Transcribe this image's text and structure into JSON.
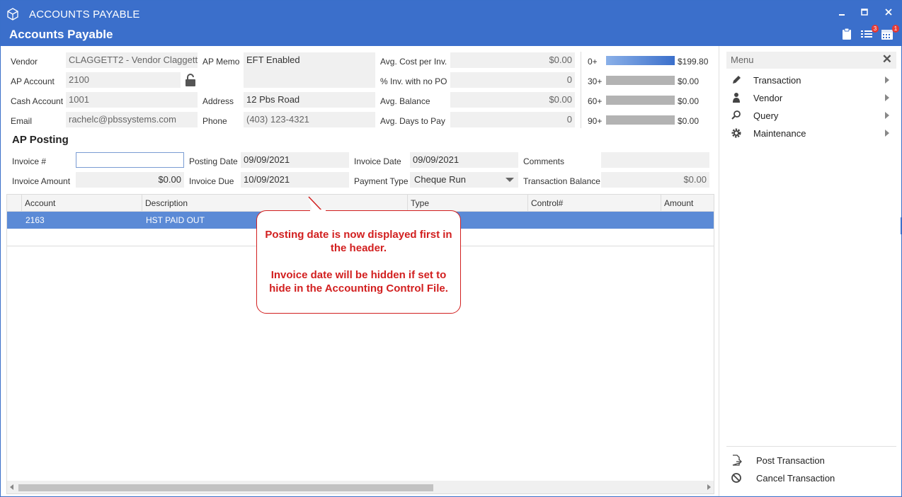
{
  "window": {
    "title": "ACCOUNTS PAYABLE",
    "page_title": "Accounts Payable",
    "notifications_badge": "3",
    "calendar_badge": "1"
  },
  "vendor": {
    "vendor_label": "Vendor",
    "vendor_value": "CLAGGETT2 - Vendor Claggett",
    "ap_account_label": "AP Account",
    "ap_account_value": "2100",
    "cash_account_label": "Cash Account",
    "cash_account_value": "1001",
    "email_label": "Email",
    "email_value": "rachelc@pbssystems.com",
    "ap_memo_label": "AP Memo",
    "ap_memo_value": "EFT Enabled",
    "address_label": "Address",
    "address_value": "12 Pbs Road",
    "phone_label": "Phone",
    "phone_value": "(403) 123-4321"
  },
  "stats": {
    "avg_cost_label": "Avg. Cost per Inv.",
    "avg_cost_value": "$0.00",
    "inv_no_po_label": "% Inv. with no PO",
    "inv_no_po_value": "0",
    "avg_balance_label": "Avg. Balance",
    "avg_balance_value": "$0.00",
    "avg_days_label": "Avg. Days to Pay",
    "avg_days_value": "0"
  },
  "aging": [
    {
      "label": "0+",
      "value": "$199.80",
      "fill": 1.0
    },
    {
      "label": "30+",
      "value": "$0.00",
      "fill": 0
    },
    {
      "label": "60+",
      "value": "$0.00",
      "fill": 0
    },
    {
      "label": "90+",
      "value": "$0.00",
      "fill": 0
    }
  ],
  "posting": {
    "section_title": "AP Posting",
    "invoice_num_label": "Invoice #",
    "invoice_num_value": "",
    "invoice_amount_label": "Invoice Amount",
    "invoice_amount_value": "$0.00",
    "posting_date_label": "Posting Date",
    "posting_date_value": "09/09/2021",
    "invoice_due_label": "Invoice Due",
    "invoice_due_value": "10/09/2021",
    "invoice_date_label": "Invoice Date",
    "invoice_date_value": "09/09/2021",
    "payment_type_label": "Payment Type",
    "payment_type_value": "Cheque Run",
    "comments_label": "Comments",
    "comments_value": "",
    "transaction_balance_label": "Transaction Balance",
    "transaction_balance_value": "$0.00"
  },
  "grid": {
    "columns": [
      "Account",
      "Description",
      "Type",
      "Control#",
      "Amount"
    ],
    "rows": [
      {
        "account": "2163",
        "description": "HST PAID OUT",
        "type": "",
        "control": "",
        "amount": ""
      }
    ]
  },
  "callout": {
    "line1": "Posting date is now displayed first in the header.",
    "line2": "Invoice date will be hidden if set to hide in the Accounting Control File."
  },
  "menu": {
    "title": "Menu",
    "items": [
      "Transaction",
      "Vendor",
      "Query",
      "Maintenance"
    ],
    "post_label": "Post Transaction",
    "cancel_label": "Cancel Transaction"
  }
}
